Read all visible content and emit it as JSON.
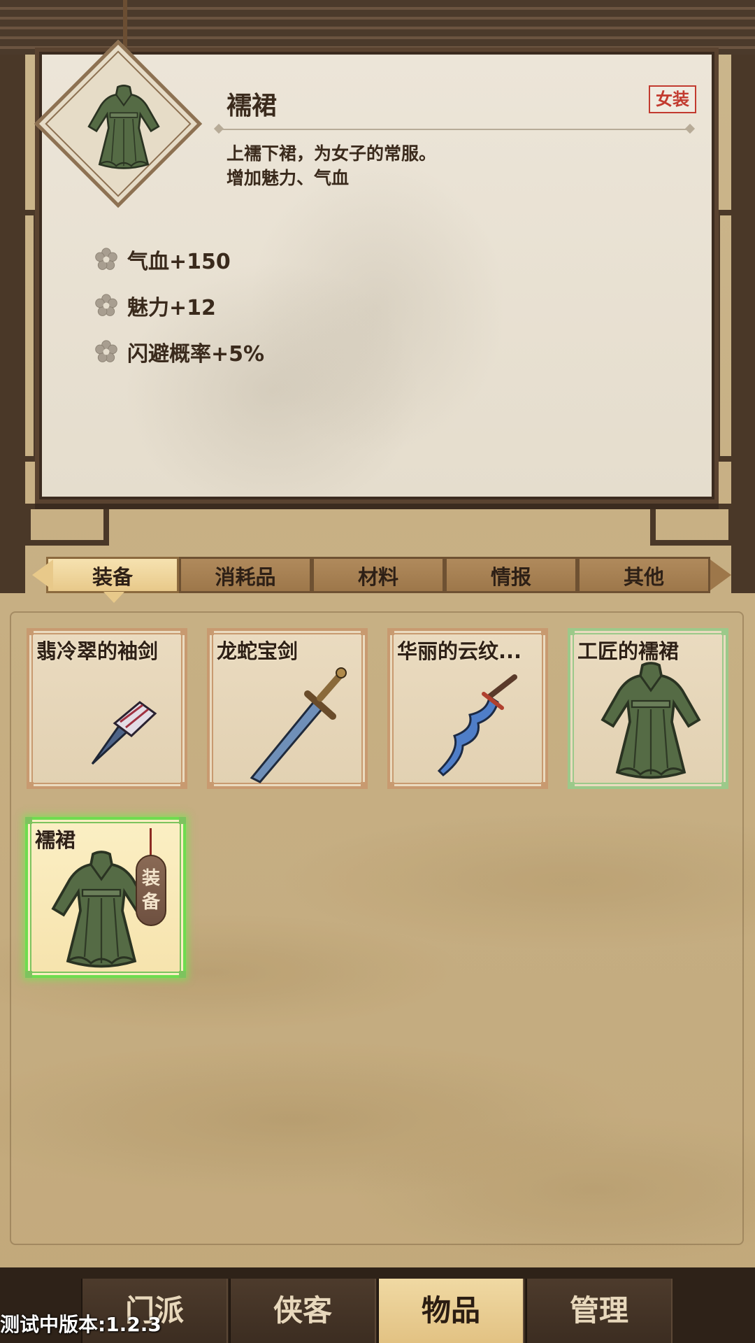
{
  "item_detail": {
    "name": "襦裙",
    "tag": "女装",
    "description": [
      "上襦下裙，为女子的常服。",
      "增加魅力、气血"
    ],
    "stats": [
      "气血+150",
      "魅力+12",
      "闪避概率+5%"
    ],
    "icon": "robe-icon"
  },
  "tabs": [
    {
      "label": "装备",
      "active": true
    },
    {
      "label": "消耗品",
      "active": false
    },
    {
      "label": "材料",
      "active": false
    },
    {
      "label": "情报",
      "active": false
    },
    {
      "label": "其他",
      "active": false
    }
  ],
  "inventory": [
    {
      "name": "翡冷翠的袖剑",
      "icon": "sleeve-dagger-icon",
      "frame": "orange"
    },
    {
      "name": "龙蛇宝剑",
      "icon": "sword-icon",
      "frame": "orange"
    },
    {
      "name": "华丽的云纹...",
      "icon": "wavy-blade-icon",
      "frame": "orange"
    },
    {
      "name": "工匠的襦裙",
      "icon": "robe-icon",
      "frame": "green"
    },
    {
      "name": "襦裙",
      "icon": "robe-icon",
      "frame": "green-selected",
      "badge": "装备"
    }
  ],
  "equip_badge": {
    "line1": "装",
    "line2": "备"
  },
  "bottom_nav": [
    {
      "label": "门派",
      "active": false
    },
    {
      "label": "侠客",
      "active": false
    },
    {
      "label": "物品",
      "active": true
    },
    {
      "label": "管理",
      "active": false
    }
  ],
  "version_text": "测试中版本:1.2.3",
  "colors": {
    "tag_red": "#c23a2f",
    "active_tab": "#e8c98a",
    "selected_glow": "#6fdc4f",
    "robe_green": "#556b45"
  }
}
